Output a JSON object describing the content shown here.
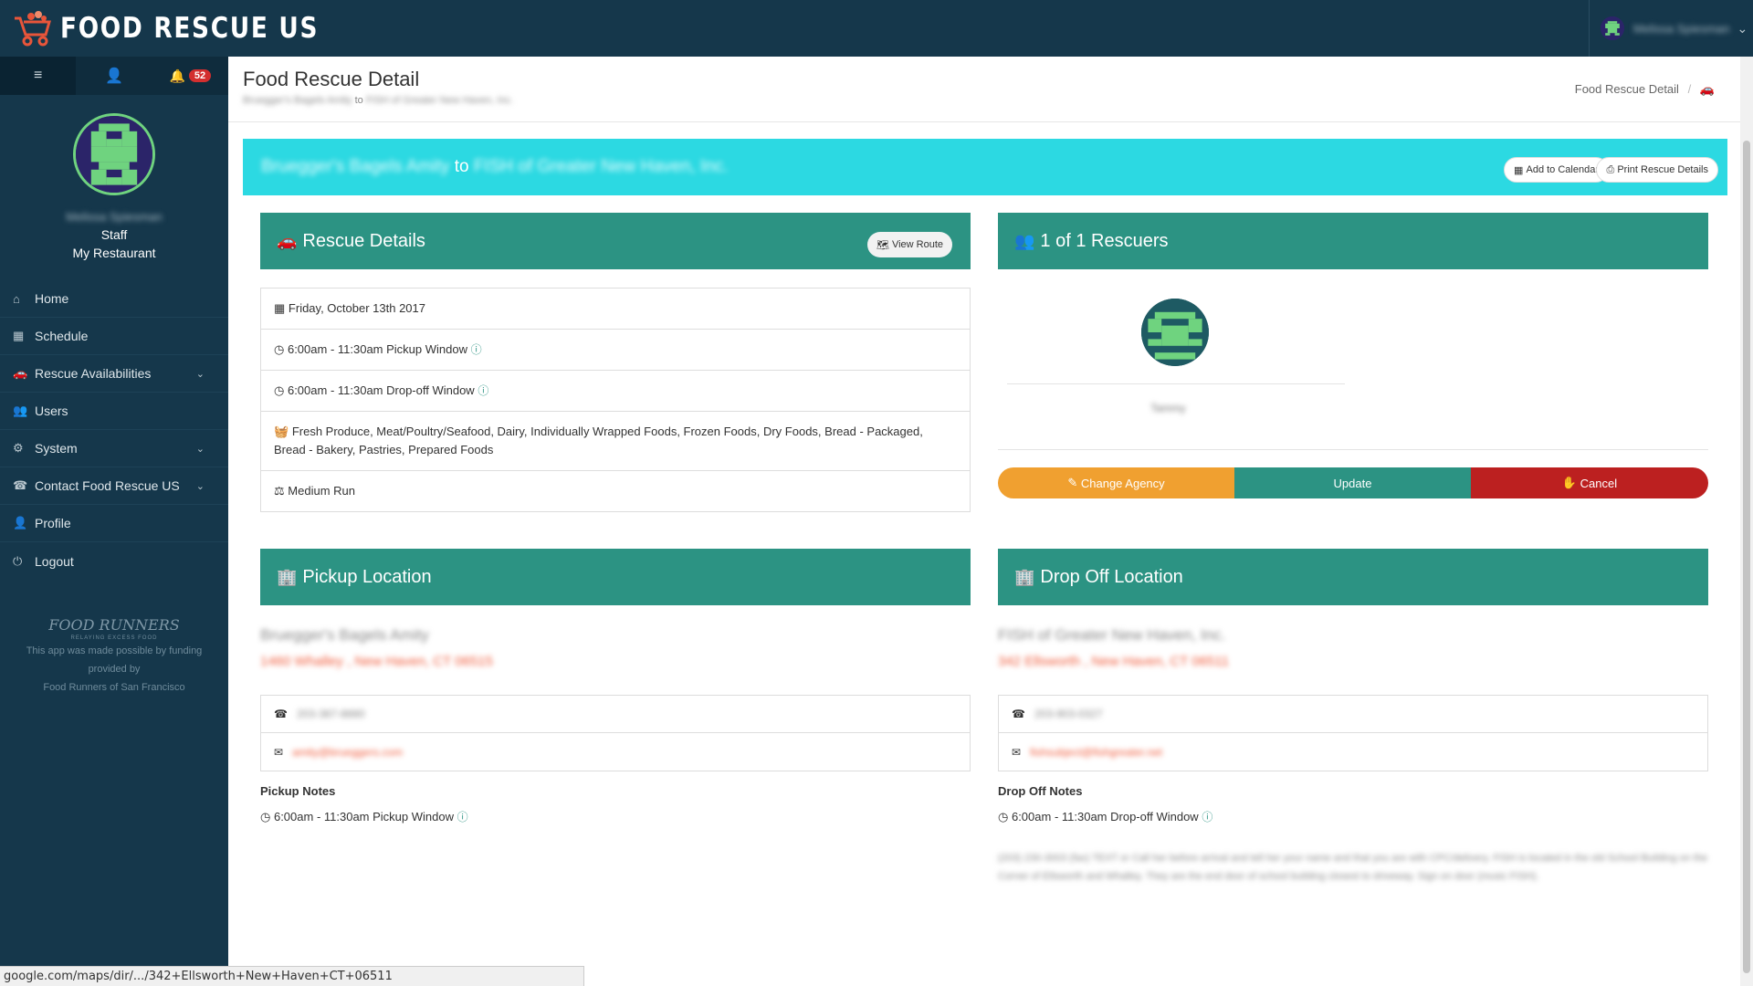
{
  "app": {
    "brand": "FOOD RESCUE US"
  },
  "user_menu": {
    "name": "Melissa Spiesman"
  },
  "sidebar": {
    "notification_count": "52",
    "profile": {
      "name": "Melissa Spiesman",
      "role": "Staff",
      "org": "My Restaurant"
    },
    "items": [
      {
        "label": "Home",
        "icon": "home-icon"
      },
      {
        "label": "Schedule",
        "icon": "calendar-icon"
      },
      {
        "label": "Rescue Availabilities",
        "icon": "car-icon",
        "caret": true
      },
      {
        "label": "Users",
        "icon": "users-icon"
      },
      {
        "label": "System",
        "icon": "gear-icon",
        "caret": true
      },
      {
        "label": "Contact Food Rescue US",
        "icon": "phone-icon",
        "caret": true
      },
      {
        "label": "Profile",
        "icon": "user-icon"
      },
      {
        "label": "Logout",
        "icon": "power-icon"
      }
    ],
    "sponsor": {
      "logo": "FOOD RUNNERS",
      "tagline": "RELAYING EXCESS FOOD",
      "line1": "This app was made possible by funding",
      "line2": "provided by",
      "line3": "Food Runners of San Francisco"
    }
  },
  "header": {
    "title": "Food Rescue Detail",
    "sub_from": "Bruegger's Bagels Amity",
    "sub_to_word": "to",
    "sub_to": "FISH of Greater New Haven, Inc.",
    "breadcrumb": "Food Rescue Detail",
    "breadcrumb_sep": "/"
  },
  "banner": {
    "from": "Bruegger's Bagels Amity",
    "to_word": "to",
    "to": "FISH of Greater New Haven, Inc.",
    "add_calendar": "Add to Calendar",
    "print": "Print Rescue Details"
  },
  "rescue_details": {
    "title": "Rescue Details",
    "view_route": "View Route",
    "date": "Friday, October 13th 2017",
    "pickup_window": "6:00am - 11:30am Pickup Window",
    "dropoff_window": "6:00am - 11:30am Drop-off Window",
    "food_types": "Fresh Produce, Meat/Poultry/Seafood, Dairy, Individually Wrapped Foods, Frozen Foods, Dry Foods, Bread - Packaged, Bread - Bakery, Pastries, Prepared Foods",
    "run_size": "Medium Run"
  },
  "rescuers": {
    "title": "1 of 1 Rescuers",
    "name": "Tammy",
    "change_agency": "Change Agency",
    "update": "Update",
    "cancel": "Cancel"
  },
  "pickup": {
    "title": "Pickup Location",
    "name": "Bruegger's Bagels Amity",
    "address": "1460 Whalley , New Haven, CT 06515",
    "phone": "203-387-8880",
    "email": "amity@brueggers.com",
    "notes_label": "Pickup Notes",
    "notes_window": "6:00am - 11:30am Pickup Window"
  },
  "dropoff": {
    "title": "Drop Off Location",
    "name": "FISH of Greater New Haven, Inc.",
    "address": "342 Ellsworth , New Haven, CT 06511",
    "phone": "203-903-0327",
    "email": "fishsubject@fishgreater.net",
    "notes_label": "Drop Off Notes",
    "notes_window": "6:00am - 11:30am Drop-off Window",
    "notes_text": "(203) 230-3003 (fax) TEXT or Call her before arrival and tell her your name and that you are with CPC/delivery. FISH is located in the old School Building on the Corner of Ellsworth and Whalley. They are the end door of school building closest to driveway. Sign on door (music FISH)."
  },
  "status_bar": {
    "url": "google.com/maps/dir/.../342+Ellsworth+New+Haven+CT+06511"
  },
  "colors": {
    "nav_bg": "#15374b",
    "teal": "#2c9383",
    "cyan": "#2cd9e2",
    "orange": "#f0a030",
    "red": "#bc2020"
  }
}
